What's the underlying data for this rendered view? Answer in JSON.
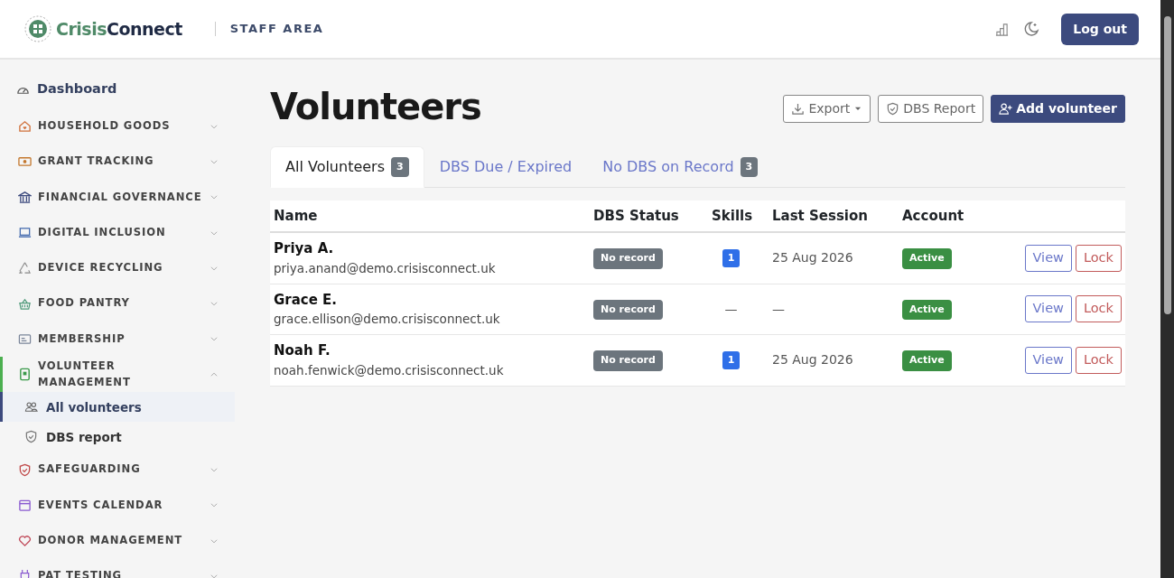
{
  "header": {
    "brand_first": "Crisis",
    "brand_second": "Connect",
    "area": "STAFF AREA",
    "logout": "Log out"
  },
  "sidebar": {
    "dashboard": "Dashboard",
    "groups": [
      {
        "label": "HOUSEHOLD GOODS",
        "expanded": false,
        "active": false
      },
      {
        "label": "GRANT TRACKING",
        "expanded": false,
        "active": false
      },
      {
        "label": "FINANCIAL GOVERNANCE",
        "expanded": false,
        "active": false
      },
      {
        "label": "DIGITAL INCLUSION",
        "expanded": false,
        "active": false
      },
      {
        "label": "DEVICE RECYCLING",
        "expanded": false,
        "active": false
      },
      {
        "label": "FOOD PANTRY",
        "expanded": false,
        "active": false
      },
      {
        "label": "MEMBERSHIP",
        "expanded": false,
        "active": false
      },
      {
        "label": "VOLUNTEER MANAGEMENT",
        "expanded": true,
        "active": true,
        "children": [
          {
            "label": "All volunteers",
            "selected": true
          },
          {
            "label": "DBS report",
            "selected": false
          }
        ]
      },
      {
        "label": "SAFEGUARDING",
        "expanded": false,
        "active": false
      },
      {
        "label": "EVENTS CALENDAR",
        "expanded": false,
        "active": false
      },
      {
        "label": "DONOR MANAGEMENT",
        "expanded": false,
        "active": false
      },
      {
        "label": "PAT TESTING",
        "expanded": false,
        "active": false
      }
    ]
  },
  "page": {
    "title": "Volunteers",
    "actions": [
      {
        "label": "Export",
        "kind": "dropdown"
      },
      {
        "label": "DBS Report",
        "kind": "outline"
      },
      {
        "label": "Add volunteer",
        "kind": "primary"
      }
    ]
  },
  "tabs": [
    {
      "label": "All Volunteers",
      "count": "3",
      "selected": true
    },
    {
      "label": "DBS Due / Expired",
      "selected": false
    },
    {
      "label": "No DBS on Record",
      "count": "3",
      "selected": false
    }
  ],
  "table": {
    "columns": [
      "Name",
      "DBS Status",
      "Skills",
      "Last Session",
      "Account"
    ],
    "rows": [
      {
        "name": "Priya A.",
        "email": "priya.anand@demo.crisisconnect.uk",
        "dbs_status": "No record",
        "skills": {
          "text": "1",
          "kind": "badge"
        },
        "last_session": "25 Aug 2026",
        "account": "Active",
        "actions": [
          "View",
          "Lock"
        ]
      },
      {
        "name": "Grace E.",
        "email": "grace.ellison@demo.crisisconnect.uk",
        "dbs_status": "No record",
        "skills": {
          "text": "—",
          "kind": "plain"
        },
        "last_session": "—",
        "account": "Active",
        "actions": [
          "View",
          "Lock"
        ]
      },
      {
        "name": "Noah F.",
        "email": "noah.fenwick@demo.crisisconnect.uk",
        "dbs_status": "No record",
        "skills": {
          "text": "1",
          "kind": "badge"
        },
        "last_session": "25 Aug 2026",
        "account": "Active",
        "actions": [
          "View",
          "Lock"
        ]
      }
    ]
  }
}
